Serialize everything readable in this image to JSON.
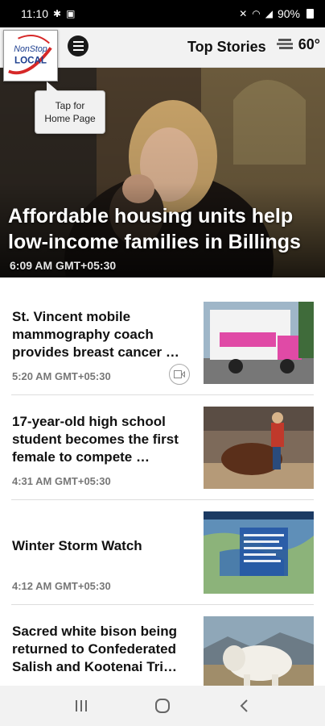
{
  "status_bar": {
    "time": "11:10",
    "battery": "90%"
  },
  "toolbar": {
    "logo_text_top": "NonStop",
    "logo_text_bottom": "LOCAL",
    "title": "Top Stories",
    "temperature": "60°"
  },
  "tooltip": {
    "line1": "Tap for",
    "line2": "Home Page"
  },
  "hero": {
    "headline": "Affordable housing units help low-income families in Billings",
    "time": "6:09 AM GMT+05:30"
  },
  "stories": [
    {
      "title": "St. Vincent mobile mammography coach provides breast cancer …",
      "time": "5:20 AM GMT+05:30",
      "has_video": true
    },
    {
      "title": "17-year-old high school student becomes the first female to compete …",
      "time": "4:31 AM GMT+05:30",
      "has_video": false
    },
    {
      "title": "Winter Storm Watch",
      "time": "4:12 AM GMT+05:30",
      "has_video": false
    },
    {
      "title": "Sacred white bison being returned to Confederated Salish and Kootenai Tri…",
      "time": "",
      "has_video": false
    }
  ],
  "colors": {
    "accent_red": "#d62828",
    "logo_blue": "#1d3f8f"
  }
}
